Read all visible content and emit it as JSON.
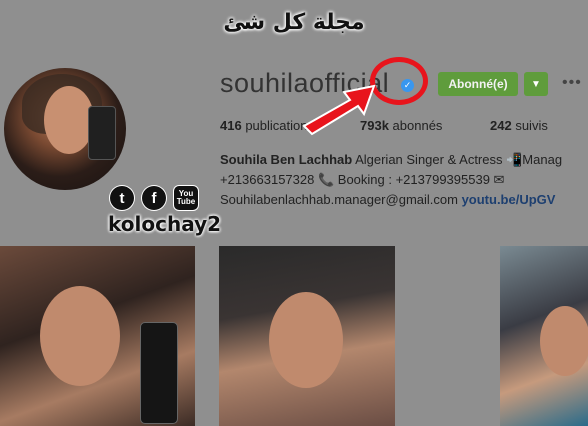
{
  "watermark": "مجلة كل شئ",
  "profile": {
    "username": "souhilaofficial",
    "verified_icon": "verified-badge-icon",
    "follow_label": "Abonné(e)",
    "more_label": "•••",
    "stats": {
      "posts_count": "416",
      "posts_label": "publications",
      "followers_count": "793k",
      "followers_label": "abonnés",
      "following_count": "242",
      "following_label": "suivis"
    },
    "bio": {
      "name": "Souhila Ben Lachhab",
      "line1_text": " Algerian Singer & Actress ",
      "line1_tail": "Manag",
      "line2_phone": "+213663157328 ",
      "line2_booking": " Booking : +213799395539 ",
      "line3_email": "Souhilabenlachhab.manager@gmail.com ",
      "line3_link": "youtu.be/UpGV"
    }
  },
  "overlay": {
    "handle": "kolochay2",
    "social_twitter": "t",
    "social_facebook": "f",
    "social_youtube_top": "You",
    "social_youtube_bottom": "Tube"
  },
  "colors": {
    "accent_green": "#5f9c3c",
    "verified_blue": "#3897f0",
    "highlight_red": "#e8141c",
    "dimmed_background": "#8f8f8f"
  }
}
